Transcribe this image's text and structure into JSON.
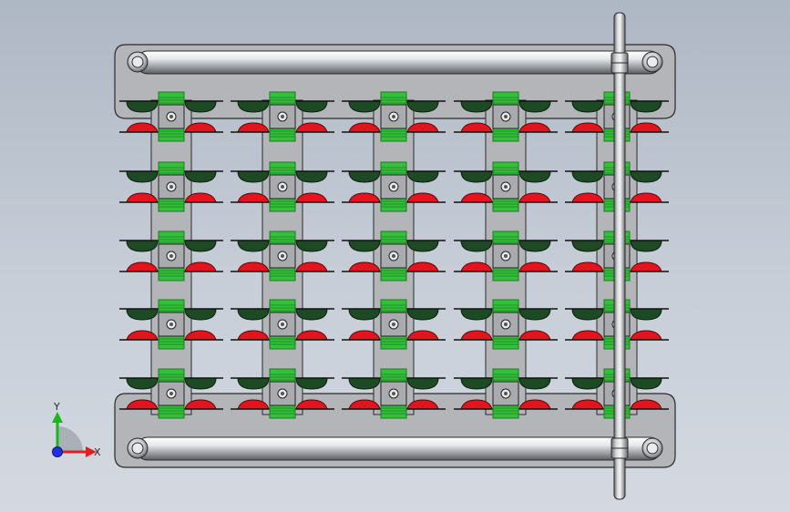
{
  "triad": {
    "x_label": "X",
    "y_label": "Y",
    "x_color": "#e02020",
    "y_color": "#18b818",
    "z_color": "#2030e0"
  },
  "assembly": {
    "columns": 5,
    "rows": 5,
    "colors": {
      "plate": "#b3b5b9",
      "plate_edge": "#2a2a2a",
      "rod_light": "#ffffff",
      "rod_mid": "#c8cacd",
      "rod_dark": "#6c6f73",
      "clip_green": "#35c03c",
      "clip_green_dark": "#1b7a22",
      "roller_dark_green": "#1d4a24",
      "roller_red": "#e2141e",
      "block_gray": "#a9abaf"
    },
    "icons": [
      "lock-collar-icon",
      "coordinate-triad-icon",
      "bolt-hole-icon"
    ]
  }
}
